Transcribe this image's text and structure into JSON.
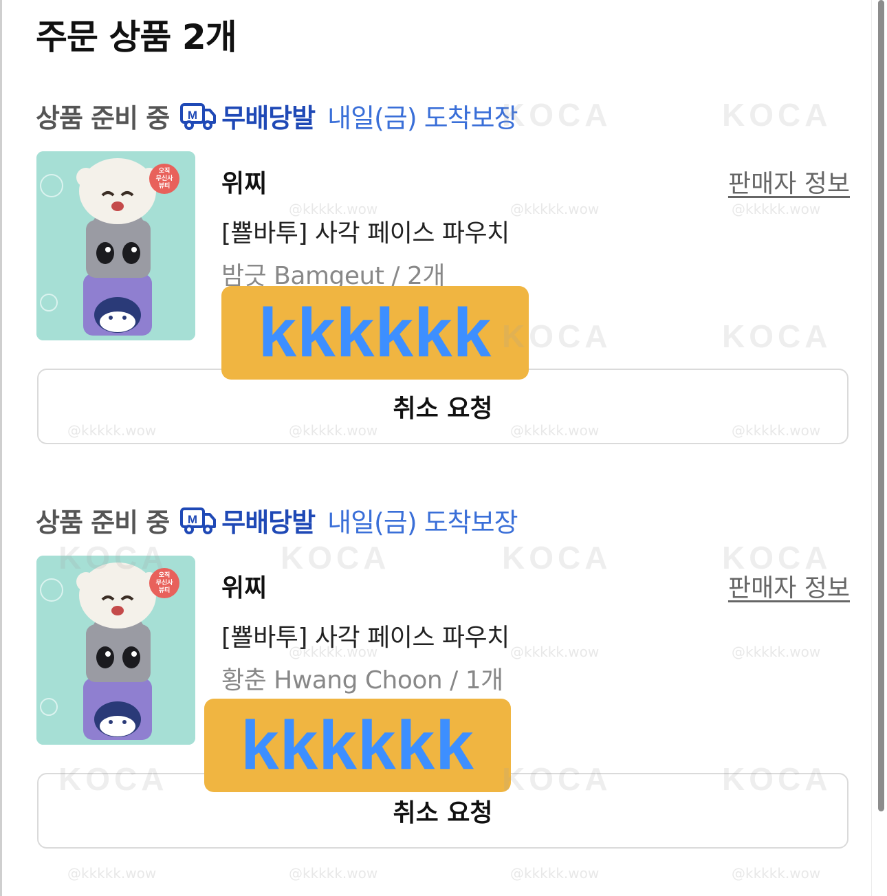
{
  "order": {
    "title": "주문 상품 2개"
  },
  "items": [
    {
      "status": "상품 준비 중",
      "delivery_brand": "무배당발",
      "delivery_eta": "내일(금) 도착보장",
      "brand": "위찌",
      "seller_link": "판매자 정보",
      "product_name": "[뾸바투] 사각 페이스 파우치",
      "option": "밤긋 Bamgeut / 2개",
      "sticker": "kkkkkk",
      "cancel_label": "취소 요청",
      "badge": [
        "오직",
        "무신사",
        "뷰티"
      ]
    },
    {
      "status": "상품 준비 중",
      "delivery_brand": "무배당발",
      "delivery_eta": "내일(금) 도착보장",
      "brand": "위찌",
      "seller_link": "판매자 정보",
      "product_name": "[뾸바투] 사각 페이스 파우치",
      "option": "황춘 Hwang Choon / 1개",
      "sticker": "kkkkkk",
      "cancel_label": "취소 요청",
      "badge": [
        "오직",
        "무신사",
        "뷰티"
      ]
    }
  ],
  "watermarks": {
    "handle": "@kkkkk.wow",
    "logo": "KOCA"
  },
  "colors": {
    "brand_blue": "#1f49b6",
    "eta_blue": "#3a6fd8",
    "sticker_bg": "#f0b541",
    "sticker_text": "#3d8fff",
    "thumb_bg": "#a8e0d6"
  }
}
